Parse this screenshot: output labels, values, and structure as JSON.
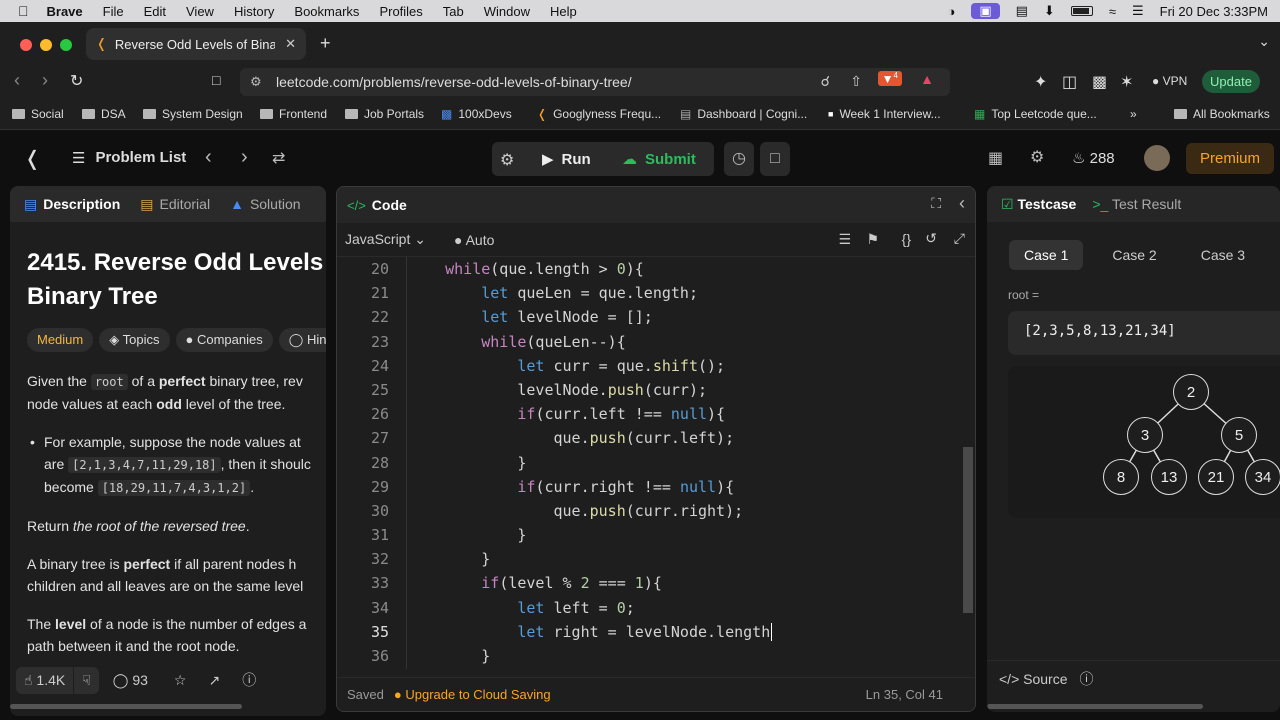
{
  "menubar": {
    "app": "Brave",
    "items": [
      "File",
      "Edit",
      "View",
      "History",
      "Bookmarks",
      "Profiles",
      "Tab",
      "Window",
      "Help"
    ],
    "datetime": "Fri 20 Dec  3:33PM"
  },
  "browser": {
    "tab_title": "Reverse Odd Levels of Binary",
    "url": "leetcode.com/problems/reverse-odd-levels-of-binary-tree/",
    "vpn": "VPN",
    "update": "Update",
    "shield_count": "4"
  },
  "bookmarks": [
    "Social",
    "DSA",
    "System Design",
    "Frontend",
    "Job Portals",
    "100xDevs",
    "Googlyness Frequ...",
    "Dashboard | Cogni...",
    "Week 1 Interview...",
    "Top Leetcode que...",
    "All Bookmarks"
  ],
  "nav": {
    "problem_list": "Problem List",
    "run": "Run",
    "submit": "Submit",
    "streak": "288",
    "premium": "Premium"
  },
  "left": {
    "tabs": [
      "Description",
      "Editorial",
      "Solution"
    ],
    "title_line1": "2415. Reverse Odd Levels",
    "title_line2": "Binary Tree",
    "difficulty": "Medium",
    "tags": [
      "Topics",
      "Companies",
      "Hin"
    ],
    "p1a": "Given the",
    "p1code": "root",
    "p1b": "of a",
    "p1strong": "perfect",
    "p1c": "binary tree, rev",
    "p1d": "node values at each",
    "p1odd": "odd",
    "p1e": "level of the tree.",
    "bullet_a": "For example, suppose the node values at",
    "bullet_b": "are",
    "bullet_code1": "[2,1,3,4,7,11,29,18]",
    "bullet_c": ", then it shoulc",
    "bullet_d": "become",
    "bullet_code2": "[18,29,11,7,4,3,1,2]",
    "bullet_e": ".",
    "p2a": "Return",
    "p2i": "the root of the reversed tree",
    "p2b": ".",
    "p3a": "A binary tree is",
    "p3strong": "perfect",
    "p3b": "if all parent nodes h",
    "p3c": "children and all leaves are on the same level",
    "p4a": "The",
    "p4strong": "level",
    "p4b": "of a node is the number of edges a",
    "p4c": "path between it and the root node.",
    "likes": "1.4K",
    "comments": "93"
  },
  "editor": {
    "header": "Code",
    "language": "JavaScript",
    "auto": "Auto",
    "saved": "Saved",
    "upgrade": "Upgrade to Cloud Saving",
    "cursor": "Ln 35, Col 41"
  },
  "testcase": {
    "tab1": "Testcase",
    "tab2": "Test Result",
    "cases": [
      "Case 1",
      "Case 2",
      "Case 3"
    ],
    "root_label": "root =",
    "root_value": "[2,3,5,8,13,21,34]",
    "source": "Source"
  },
  "tree": {
    "nodes": [
      {
        "val": "2",
        "level": 0
      },
      {
        "val": "3",
        "level": 1
      },
      {
        "val": "5",
        "level": 1
      },
      {
        "val": "8",
        "level": 2
      },
      {
        "val": "13",
        "level": 2
      },
      {
        "val": "21",
        "level": 2
      },
      {
        "val": "34",
        "level": 2
      }
    ]
  },
  "code_lines": [
    {
      "n": "20",
      "t": "    while(que.length > 0){"
    },
    {
      "n": "21",
      "t": "        let queLen = que.length;"
    },
    {
      "n": "22",
      "t": "        let levelNode = [];"
    },
    {
      "n": "23",
      "t": "        while(queLen--){"
    },
    {
      "n": "24",
      "t": "            let curr = que.shift();"
    },
    {
      "n": "25",
      "t": "            levelNode.push(curr);"
    },
    {
      "n": "26",
      "t": "            if(curr.left !== null){"
    },
    {
      "n": "27",
      "t": "                que.push(curr.left);"
    },
    {
      "n": "28",
      "t": "            }"
    },
    {
      "n": "29",
      "t": "            if(curr.right !== null){"
    },
    {
      "n": "30",
      "t": "                que.push(curr.right);"
    },
    {
      "n": "31",
      "t": "            }"
    },
    {
      "n": "32",
      "t": "        }"
    },
    {
      "n": "33",
      "t": "        if(level % 2 === 1){"
    },
    {
      "n": "34",
      "t": "            let left = 0;"
    },
    {
      "n": "35",
      "t": "            let right = levelNode.length"
    },
    {
      "n": "36",
      "t": "        }"
    }
  ]
}
